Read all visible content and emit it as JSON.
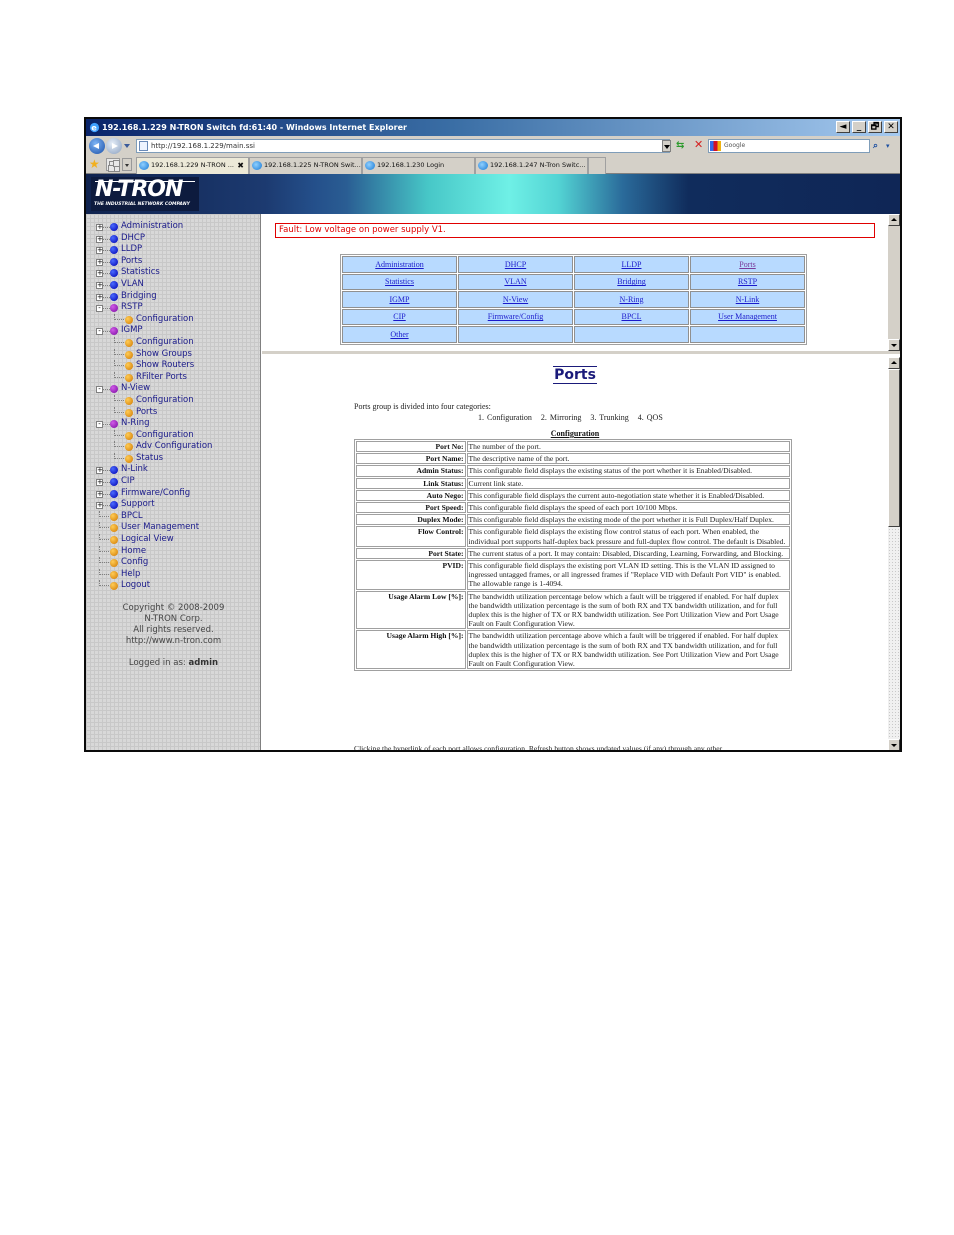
{
  "window": {
    "title": "192.168.1.229 N-TRON Switch fd:61:40 - Windows Internet Explorer",
    "controls": [
      "◄",
      "_",
      "🗗",
      "✕"
    ]
  },
  "address_bar": {
    "url": "http://192.168.1.229/main.ssi",
    "search_placeholder": "Google"
  },
  "tabs": [
    {
      "label": "192.168.1.229 N-TRON ...",
      "active": true,
      "close": "✖"
    },
    {
      "label": "192.168.1.225 N-TRON Swit...",
      "active": false
    },
    {
      "label": "192.168.1.230 Login",
      "active": false
    },
    {
      "label": "192.168.1.247 N-Tron Switc...",
      "active": false
    }
  ],
  "banner": {
    "logo": "N-TRON",
    "tagline": "THE INDUSTRIAL NETWORK COMPANY"
  },
  "sidebar": {
    "tree": [
      {
        "label": "Administration",
        "level": 0,
        "expander": "+",
        "bullet": "blue"
      },
      {
        "label": "DHCP",
        "level": 0,
        "expander": "+",
        "bullet": "blue"
      },
      {
        "label": "LLDP",
        "level": 0,
        "expander": "+",
        "bullet": "blue"
      },
      {
        "label": "Ports",
        "level": 0,
        "expander": "+",
        "bullet": "blue"
      },
      {
        "label": "Statistics",
        "level": 0,
        "expander": "+",
        "bullet": "blue"
      },
      {
        "label": "VLAN",
        "level": 0,
        "expander": "+",
        "bullet": "blue"
      },
      {
        "label": "Bridging",
        "level": 0,
        "expander": "+",
        "bullet": "blue"
      },
      {
        "label": "RSTP",
        "level": 0,
        "expander": "-",
        "bullet": "purple"
      },
      {
        "label": "Configuration",
        "level": 1,
        "bullet": "orange"
      },
      {
        "label": "IGMP",
        "level": 0,
        "expander": "-",
        "bullet": "purple"
      },
      {
        "label": "Configuration",
        "level": 1,
        "bullet": "orange"
      },
      {
        "label": "Show Groups",
        "level": 1,
        "bullet": "orange"
      },
      {
        "label": "Show Routers",
        "level": 1,
        "bullet": "orange"
      },
      {
        "label": "RFilter Ports",
        "level": 1,
        "bullet": "orange"
      },
      {
        "label": "N-View",
        "level": 0,
        "expander": "-",
        "bullet": "purple"
      },
      {
        "label": "Configuration",
        "level": 1,
        "bullet": "orange"
      },
      {
        "label": "Ports",
        "level": 1,
        "bullet": "orange"
      },
      {
        "label": "N-Ring",
        "level": 0,
        "expander": "-",
        "bullet": "purple"
      },
      {
        "label": "Configuration",
        "level": 1,
        "bullet": "orange"
      },
      {
        "label": "Adv Configuration",
        "level": 1,
        "bullet": "orange"
      },
      {
        "label": "Status",
        "level": 1,
        "bullet": "orange"
      },
      {
        "label": "N-Link",
        "level": 0,
        "expander": "+",
        "bullet": "blue"
      },
      {
        "label": "CIP",
        "level": 0,
        "expander": "+",
        "bullet": "blue"
      },
      {
        "label": "Firmware/Config",
        "level": 0,
        "expander": "+",
        "bullet": "blue"
      },
      {
        "label": "Support",
        "level": 0,
        "expander": "+",
        "bullet": "blue"
      },
      {
        "label": "BPCL",
        "level": 0,
        "bullet": "orange"
      },
      {
        "label": "User Management",
        "level": 0,
        "bullet": "orange"
      },
      {
        "label": "Logical View",
        "level": 0,
        "bullet": "orange"
      },
      {
        "label": "Home",
        "level": 0,
        "bullet": "orange"
      },
      {
        "label": "Config",
        "level": 0,
        "bullet": "orange"
      },
      {
        "label": "Help",
        "level": 0,
        "bullet": "orange"
      },
      {
        "label": "Logout",
        "level": 0,
        "bullet": "orange"
      }
    ],
    "copyright": [
      "Copyright © 2008-2009",
      "N-TRON Corp.",
      "All rights reserved.",
      "http://www.n-tron.com"
    ],
    "logged_in_label": "Logged in as:",
    "logged_in_user": "admin"
  },
  "top_frame": {
    "fault": "Fault:  Low voltage on power supply V1.",
    "nav_links": [
      [
        "Administration",
        "DHCP",
        "LLDP",
        "Ports"
      ],
      [
        "Statistics",
        "VLAN",
        "Bridging",
        "RSTP"
      ],
      [
        "IGMP",
        "N-View",
        "N-Ring",
        "N-Link"
      ],
      [
        "CIP",
        "Firmware/Config",
        "BPCL",
        "User Management"
      ],
      [
        "Other",
        "",
        "",
        ""
      ]
    ],
    "visited_link": "Ports"
  },
  "help_page": {
    "title": "Ports",
    "intro": "Ports group is divided into four categories:",
    "categories": "1. Configuration   2. Mirroring   3. Trunking   4. QOS",
    "section_heading": "Configuration",
    "fields": [
      {
        "name": "Port No:",
        "desc": "The number of the port."
      },
      {
        "name": "Port Name:",
        "desc": "The descriptive name of the port."
      },
      {
        "name": "Admin Status:",
        "desc": "This configurable field displays the existing status of the port whether it is Enabled/Disabled."
      },
      {
        "name": "Link Status:",
        "desc": "Current link state."
      },
      {
        "name": "Auto Nego:",
        "desc": "This configurable field displays the current auto-negotiation state whether it is Enabled/Disabled."
      },
      {
        "name": "Port Speed:",
        "desc": "This configurable field displays the speed of each port 10/100 Mbps."
      },
      {
        "name": "Duplex Mode:",
        "desc": "This configurable field displays the existing mode of the port whether it is Full Duplex/Half Duplex."
      },
      {
        "name": "Flow Control:",
        "desc": "This configurable field displays the existing flow control status of each port. When enabled, the individual port supports half-duplex back pressure and full-duplex flow control. The default is Disabled."
      },
      {
        "name": "Port State:",
        "desc": "The current status of a port. It may contain: Disabled, Discarding, Learning, Forwarding, and Blocking."
      },
      {
        "name": "PVID:",
        "desc": "This configurable field displays the existing port VLAN ID setting. This is the VLAN ID assigned to ingressed untagged frames, or all ingressed frames if \"Replace VID with Default Port VID\" is enabled. The allowable range is 1-4094."
      },
      {
        "name": "Usage Alarm Low [%]:",
        "desc": "The bandwidth utilization percentage below which a fault will be triggered if enabled. For half duplex the bandwidth utilization percentage is the sum of both RX and TX bandwidth utilization, and for full duplex this is the higher of TX or RX bandwidth utilization. See Port Utilization View and Port Usage Fault on Fault Configuration View."
      },
      {
        "name": "Usage Alarm High [%]:",
        "desc": "The bandwidth utilization percentage above which a fault will be triggered if enabled. For half duplex the bandwidth utilization percentage is the sum of both RX and TX bandwidth utilization, and for full duplex this is the higher of TX or RX bandwidth utilization. See Port Utilization View and Port Usage Fault on Fault Configuration View."
      }
    ],
    "footer": "Clicking the hyperlink of each port allows configuration. Refresh button shows updated values (if any) through any other"
  }
}
